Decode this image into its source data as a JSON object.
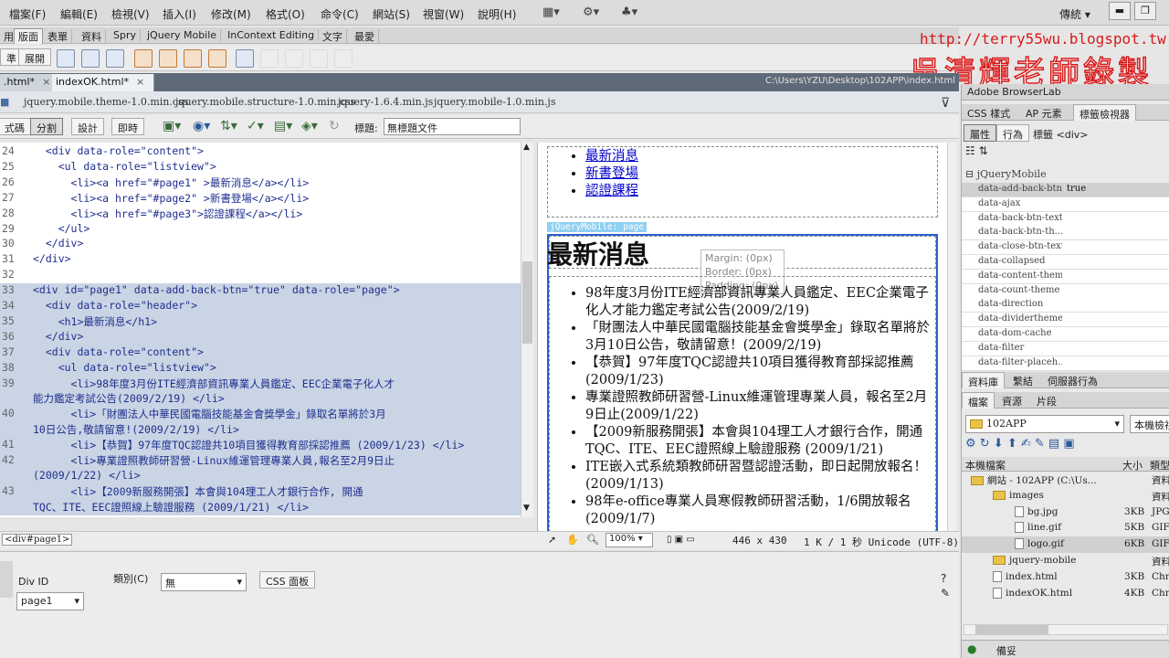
{
  "menu": [
    "檔案(F)",
    "編輯(E)",
    "檢視(V)",
    "插入(I)",
    "修改(M)",
    "格式(O)",
    "命令(C)",
    "網站(S)",
    "視窗(W)",
    "說明(H)"
  ],
  "workspace": "傳統",
  "insert_tabs": [
    "用",
    "版面",
    "表單",
    "資料",
    "Spry",
    "jQuery Mobile",
    "InContext Editing",
    "文字",
    "最愛"
  ],
  "insert_left": [
    "準",
    "展開"
  ],
  "doc_tabs": [
    ".html*",
    "indexOK.html*"
  ],
  "doc_path": "C:\\Users\\YZU\\Desktop\\102APP\\index.html",
  "related_files": [
    "jquery.mobile.theme-1.0.min.css",
    "jquery.mobile.structure-1.0.min.css",
    "jquery-1.6.4.min.js",
    "jquery.mobile-1.0.min.js"
  ],
  "views": [
    "式碼",
    "分割",
    "設計",
    "即時"
  ],
  "title_label": "標題:",
  "title_value": "無標題文件",
  "code_lines": [
    {
      "n": "24",
      "t": "  <div data-role=\"content\">"
    },
    {
      "n": "25",
      "t": "    <ul data-role=\"listview\">"
    },
    {
      "n": "26",
      "t": "      <li><a href=\"#page1\" >最新消息</a></li>"
    },
    {
      "n": "27",
      "t": "      <li><a href=\"#page2\" >新書登場</a></li>"
    },
    {
      "n": "28",
      "t": "      <li><a href=\"#page3\">認證課程</a></li>"
    },
    {
      "n": "29",
      "t": "    </ul>"
    },
    {
      "n": "30",
      "t": "  </div>"
    },
    {
      "n": "31",
      "t": "</div>"
    },
    {
      "n": "32",
      "t": ""
    },
    {
      "n": "33",
      "t": "<div id=\"page1\" data-add-back-btn=\"true\" data-role=\"page\">"
    },
    {
      "n": "34",
      "t": "  <div data-role=\"header\">"
    },
    {
      "n": "35",
      "t": "    <h1>最新消息</h1>"
    },
    {
      "n": "36",
      "t": "  </div>"
    },
    {
      "n": "37",
      "t": "  <div data-role=\"content\">"
    },
    {
      "n": "38",
      "t": "    <ul data-role=\"listview\">"
    },
    {
      "n": "39",
      "t": "      <li>98年度3月份ITE經濟部資訊專業人員鑑定、EEC企業電子化人才"
    },
    {
      "n": "",
      "t": "能力鑑定考試公告(2009/2/19) </li>"
    },
    {
      "n": "40",
      "t": "      <li>「財團法人中華民國電腦技能基金會獎學金」錄取名單將於3月"
    },
    {
      "n": "",
      "t": "10日公告,敬請留意!(2009/2/19) </li>"
    },
    {
      "n": "41",
      "t": "      <li>【恭賀】97年度TQC認證共10項目獲得教育部採認推薦 (2009/1/23) </li>"
    },
    {
      "n": "42",
      "t": "      <li>專業證照教師研習營-Linux維運管理專業人員,報名至2月9日止"
    },
    {
      "n": "",
      "t": "(2009/1/22) </li>"
    },
    {
      "n": "43",
      "t": "      <li>【2009新服務開張】本會與104理工人才銀行合作, 開通"
    },
    {
      "n": "",
      "t": "TQC、ITE、EEC證照線上驗證服務 (2009/1/21) </li>"
    }
  ],
  "design": {
    "nav_links": [
      "最新消息",
      "新書登場",
      "認證課程"
    ],
    "page_tag": "jQueryMobile: page",
    "heading": "最新消息",
    "tooltip": [
      "Margin:   (0px)",
      "Border:   (0px)",
      "Padding: (0px)"
    ],
    "news": [
      "98年度3月份ITE經濟部資訊專業人員鑑定、EEC企業電子化人才能力鑑定考試公告(2009/2/19)",
      "「財團法人中華民國電腦技能基金會獎學金」錄取名單將於3月10日公告，敬請留意！(2009/2/19)",
      "【恭賀】97年度TQC認證共10項目獲得教育部採認推薦(2009/1/23)",
      "專業證照教師研習營-Linux維運管理專業人員，報名至2月9日止(2009/1/22)",
      "【2009新服務開張】本會與104理工人才銀行合作，開通TQC、ITE、EEC證照線上驗證服務 (2009/1/21)",
      "ITE嵌入式系統類教師研習暨認證活動，即日起開放報名！(2009/1/13)",
      "98年e-office專業人員寒假教師研習活動，1/6開放報名(2009/1/7)"
    ]
  },
  "status": {
    "tag": "<div#page1>",
    "zoom": "100%",
    "size": "446 x 430",
    "info": "1 K / 1 秒  Unicode (UTF-8)"
  },
  "properties": {
    "divid_label": "Div ID",
    "divid_value": "page1",
    "class_label": "類別(C)",
    "class_value": "無",
    "css_button": "CSS 面板"
  },
  "right_panel": {
    "browserlab": "Adobe BrowserLab",
    "tabs": [
      "CSS 樣式",
      "AP 元素",
      "標籤檢視器"
    ],
    "subtabs": [
      "屬性",
      "行為"
    ],
    "tag_label": "標籤 <div>",
    "group": "jQueryMobile",
    "attrs": [
      {
        "k": "data-add-back-btn",
        "v": "true"
      },
      {
        "k": "data-ajax",
        "v": ""
      },
      {
        "k": "data-back-btn-text",
        "v": ""
      },
      {
        "k": "data-back-btn-th...",
        "v": ""
      },
      {
        "k": "data-close-btn-text",
        "v": ""
      },
      {
        "k": "data-collapsed",
        "v": ""
      },
      {
        "k": "data-content-theme",
        "v": ""
      },
      {
        "k": "data-count-theme",
        "v": ""
      },
      {
        "k": "data-direction",
        "v": ""
      },
      {
        "k": "data-dividertheme",
        "v": ""
      },
      {
        "k": "data-dom-cache",
        "v": ""
      },
      {
        "k": "data-filter",
        "v": ""
      },
      {
        "k": "data-filter-placeh...",
        "v": ""
      }
    ],
    "lower_tabs": [
      "資料庫",
      "繫結",
      "伺服器行為"
    ],
    "files_tabs": [
      "檔案",
      "資源",
      "片段"
    ],
    "site_select": "102APP",
    "view_select": "本機檢視",
    "col_local": "本機檔案",
    "col_size": "大小",
    "col_type": "類型",
    "files": [
      {
        "name": "網站 - 102APP (C:\\Us...",
        "size": "",
        "type": "資料",
        "indent": 0,
        "kind": "site"
      },
      {
        "name": "images",
        "size": "",
        "type": "資料",
        "indent": 1,
        "kind": "folder"
      },
      {
        "name": "bg.jpg",
        "size": "3KB",
        "type": "JPG",
        "indent": 2,
        "kind": "file"
      },
      {
        "name": "line.gif",
        "size": "5KB",
        "type": "GIF",
        "indent": 2,
        "kind": "file"
      },
      {
        "name": "logo.gif",
        "size": "6KB",
        "type": "GIF",
        "indent": 2,
        "kind": "file"
      },
      {
        "name": "jquery-mobile",
        "size": "",
        "type": "資料",
        "indent": 1,
        "kind": "folder"
      },
      {
        "name": "index.html",
        "size": "3KB",
        "type": "Chro",
        "indent": 1,
        "kind": "file"
      },
      {
        "name": "indexOK.html",
        "size": "4KB",
        "type": "Chro",
        "indent": 1,
        "kind": "file"
      }
    ],
    "footer": "備妥"
  },
  "watermark": {
    "url": "http://terry55wu.blogspot.tw",
    "name": "吳清輝老師錄製"
  }
}
